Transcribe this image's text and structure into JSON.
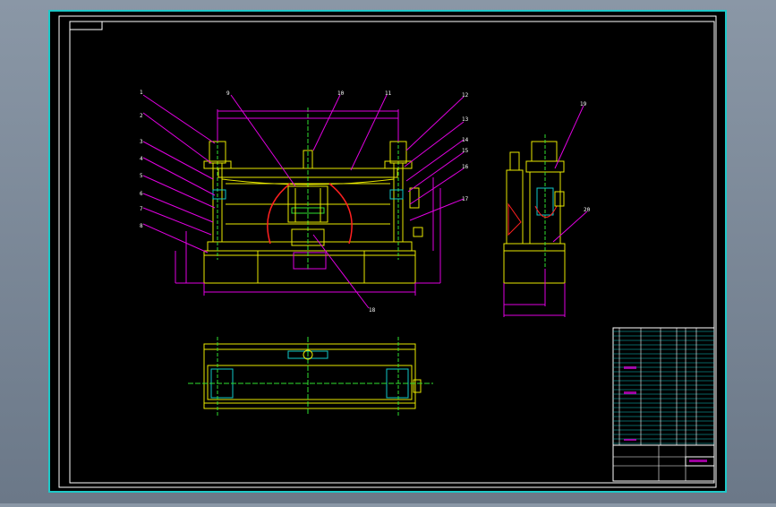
{
  "app": {
    "title": ""
  },
  "drawing": {
    "part_labels": [
      "1",
      "2",
      "3",
      "4",
      "5",
      "6",
      "7",
      "8",
      "9",
      "10",
      "11",
      "12",
      "13",
      "14",
      "15",
      "16",
      "17",
      "18",
      "19",
      "20"
    ],
    "title_block": {
      "drawing_name": ""
    }
  },
  "colors": {
    "background": "#000000",
    "frame": "#ffffff",
    "border_outer": "#1ec8c8",
    "geometry": "#e8e800",
    "dimension": "#e000e0",
    "centerline": "#30e030",
    "accent": "#ff2020",
    "detail": "#10c8c8"
  }
}
